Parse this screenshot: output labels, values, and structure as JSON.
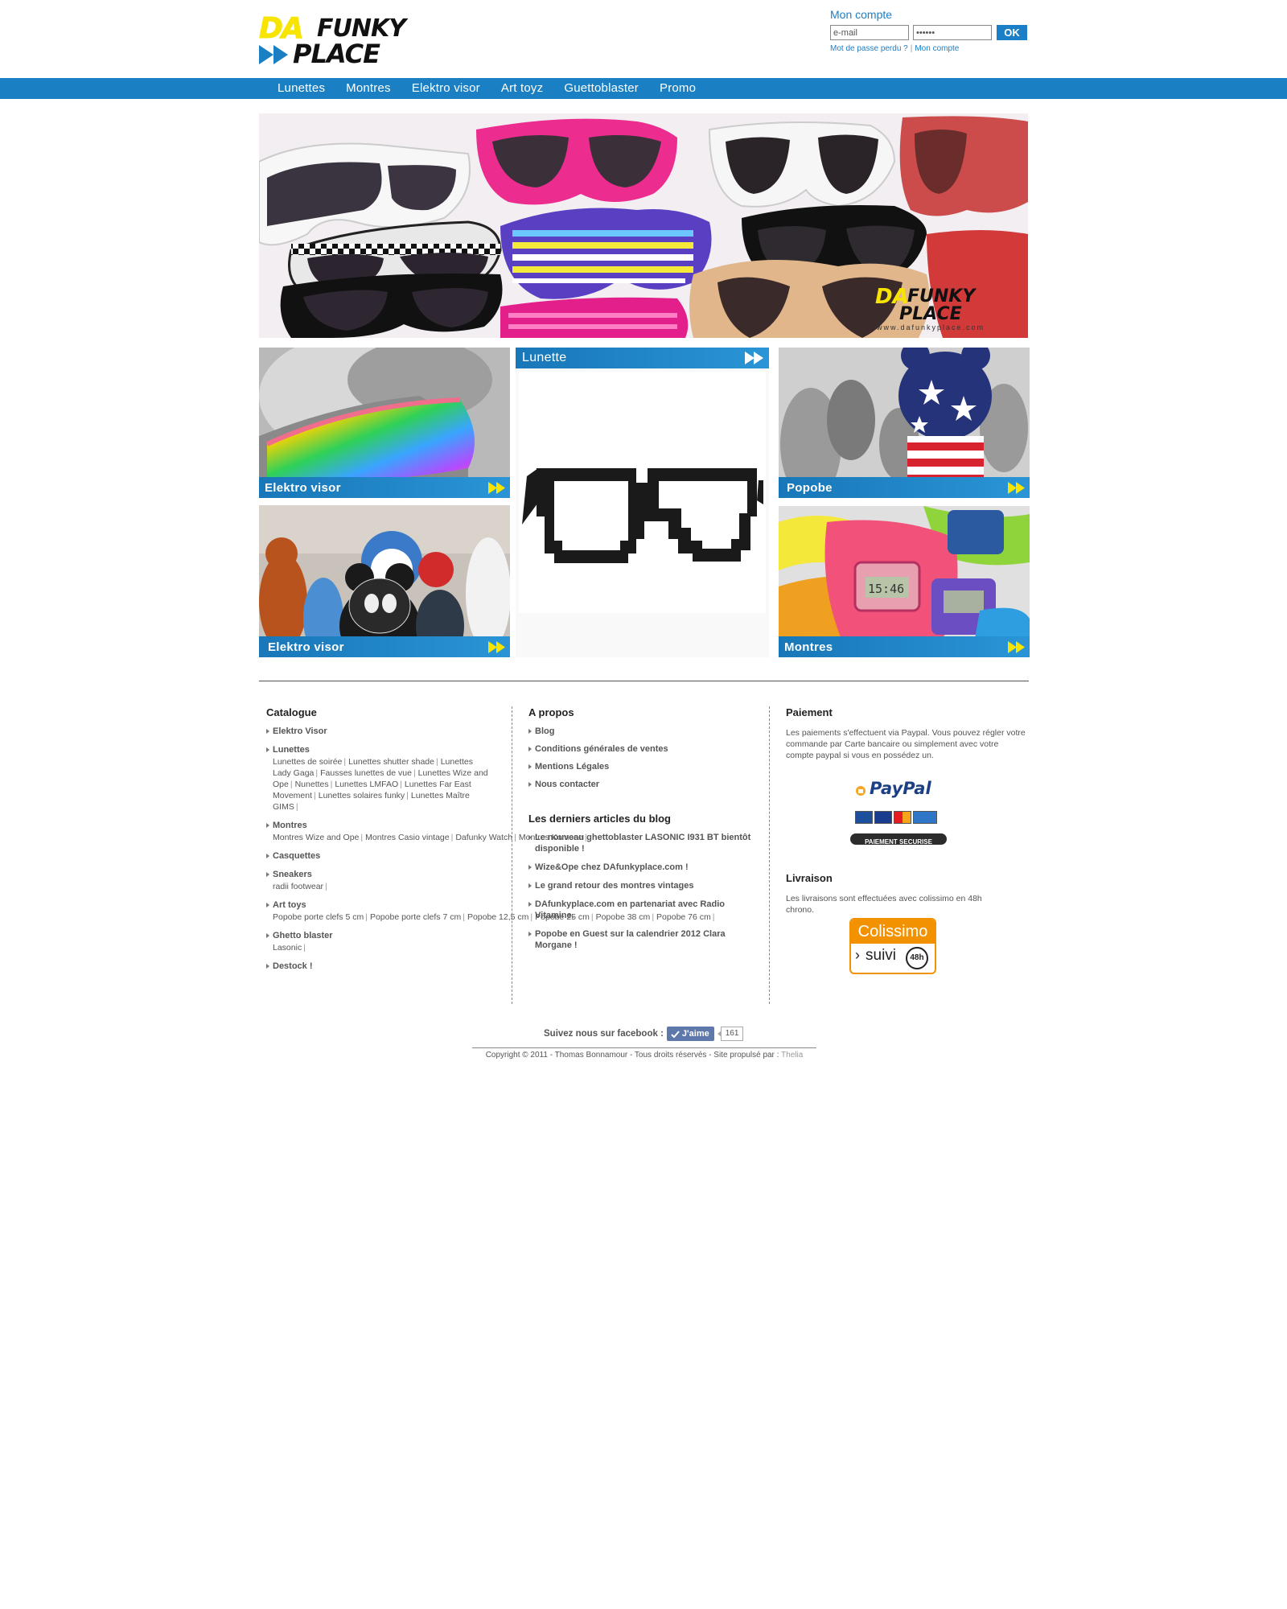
{
  "header": {
    "logo": {
      "da": "DA",
      "funky": "FUNKY",
      "place": "PLACE"
    },
    "account": {
      "title": "Mon compte",
      "email_value": "e-mail",
      "password_value": "••••••",
      "ok_label": "OK",
      "lost_password": "Mot de passe perdu ?",
      "my_account": "Mon compte"
    }
  },
  "nav": {
    "items": [
      "Lunettes",
      "Montres",
      "Elektro visor",
      "Art toyz",
      "Guettoblaster",
      "Promo"
    ]
  },
  "banner": {
    "logo": {
      "da": "DA",
      "funky": "FUNKY",
      "place": "PLACE",
      "url": "www.dafunkyplace.com"
    }
  },
  "tiles": {
    "top_left": "Elektro visor",
    "bottom_left": "Elektro visor",
    "top_right": "Popobe",
    "bottom_right": "Montres",
    "feature": "Lunette"
  },
  "footer": {
    "catalogue": {
      "title": "Catalogue",
      "sections": [
        {
          "name": "Elektro Visor",
          "subs": []
        },
        {
          "name": "Lunettes",
          "subs": [
            "Lunettes de soirée",
            "Lunettes shutter shade",
            "Lunettes Lady Gaga",
            "Fausses lunettes de vue",
            "Lunettes Wize and Ope",
            "Nunettes",
            "Lunettes LMFAO",
            "Lunettes Far East Movement",
            "Lunettes solaires funky",
            "Lunettes Maître GIMS"
          ]
        },
        {
          "name": "Montres",
          "subs": [
            "Montres Wize and Ope",
            "Montres Casio vintage",
            "Dafunky Watch",
            "Montres Komono"
          ]
        },
        {
          "name": "Casquettes",
          "subs": []
        },
        {
          "name": "Sneakers",
          "subs": [
            "radii footwear"
          ]
        },
        {
          "name": "Art toys",
          "subs": [
            "Popobe porte clefs 5 cm",
            "Popobe porte clefs 7 cm",
            "Popobe 12,5 cm",
            "Popobe 25 cm",
            "Popobe 38 cm",
            "Popobe 76 cm"
          ]
        },
        {
          "name": "Ghetto blaster",
          "subs": [
            "Lasonic"
          ]
        },
        {
          "name": "Destock !",
          "subs": []
        }
      ]
    },
    "apropos": {
      "title": "A propos",
      "links": [
        "Blog",
        "Conditions générales de ventes",
        "Mentions Légales",
        "Nous contacter"
      ],
      "blog_title": "Les derniers articles du blog",
      "articles": [
        "Le nouveau ghettoblaster LASONIC I931 BT bientôt disponible !",
        "Wize&Ope chez DAfunkyplace.com !",
        "Le grand retour des montres vintages",
        "DAfunkyplace.com en partenariat avec Radio Vitamine.",
        "Popobe en Guest sur la calendrier 2012 Clara Morgane !"
      ]
    },
    "paiement": {
      "title": "Paiement",
      "text": "Les paiements s'effectuent via Paypal. Vous pouvez régler votre commande par Carte bancaire ou simplement avec votre compte paypal si vous en possédez un.",
      "paypal_label": "PayPal",
      "paypal_secure": "PAIEMENT SECURISE",
      "livraison_title": "Livraison",
      "livraison_text": "Les livraisons sont effectuées avec colissimo en 48h chrono.",
      "colissimo_label": "Colissimo",
      "colissimo_suivi": "suivi",
      "colissimo_48": "48h"
    }
  },
  "bottom": {
    "facebook_text": "Suivez nous sur facebook :",
    "like_label": "J'aime",
    "like_count": "161",
    "copyright_text": "Copyright © 2011 - Thomas Bonnamour - Tous droits réservés - Site propulsé par : ",
    "powered_by": "Thelia"
  },
  "colors": {
    "brand_blue": "#1b7fc4",
    "brand_yellow": "#f7e400"
  }
}
